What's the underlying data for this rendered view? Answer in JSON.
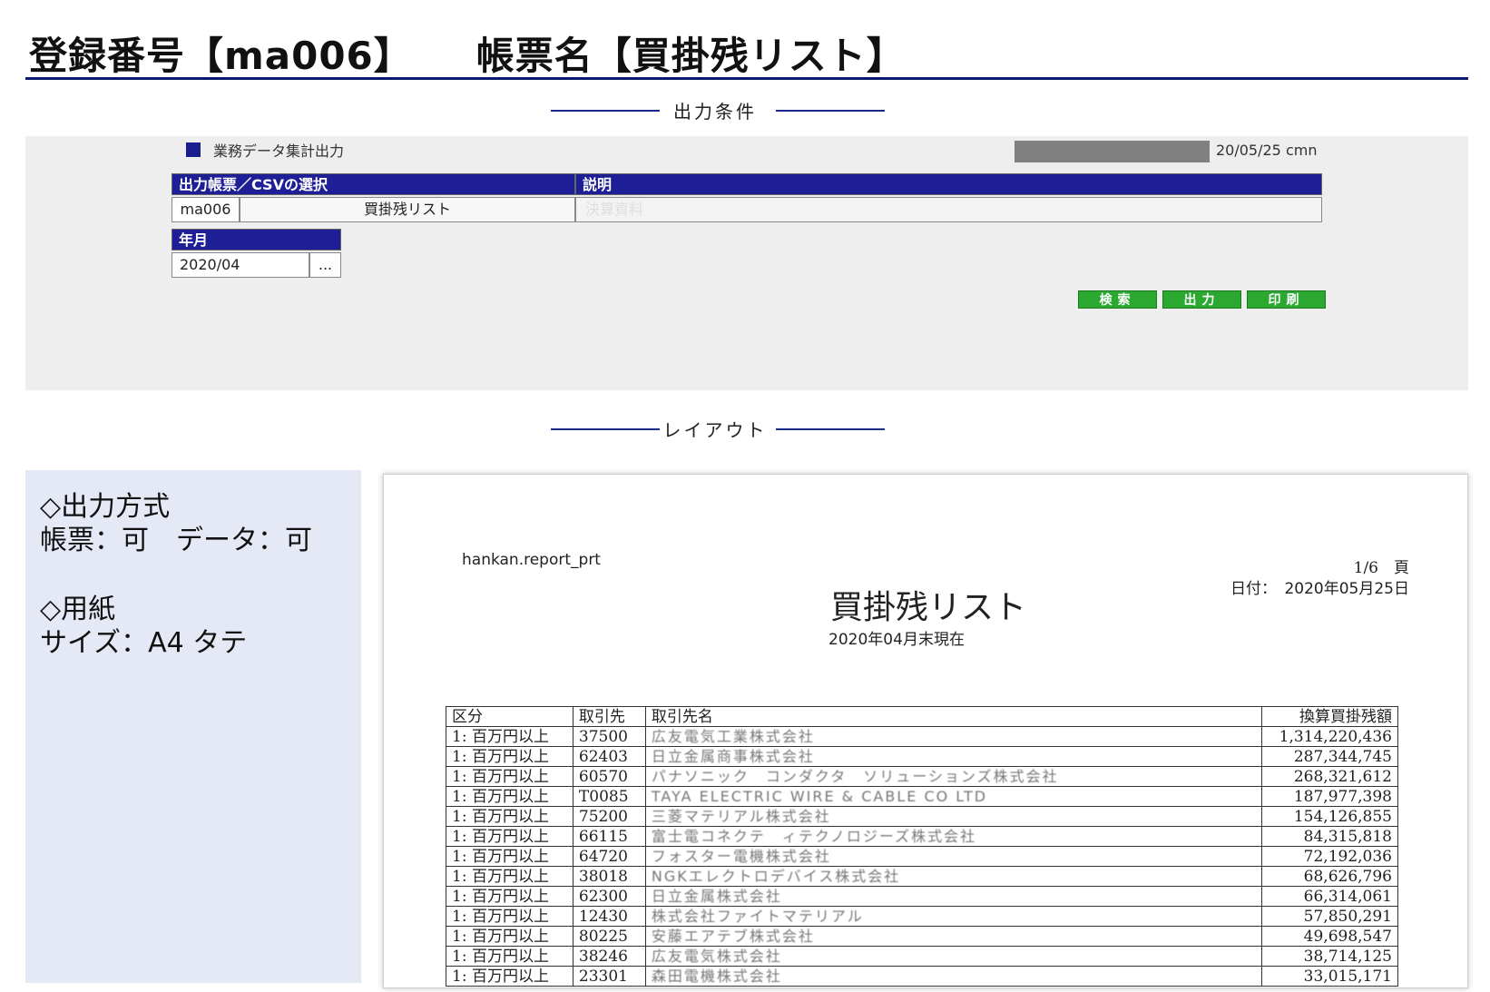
{
  "header": {
    "registration": "登録番号【ma006】",
    "form_name": "帳票名【買掛残リスト】"
  },
  "conditions": {
    "section_label": "出力条件",
    "subtitle": "業務データ集計出力",
    "date_user": "20/05/25 cmn",
    "form_select_header": "出力帳票／CSVの選択",
    "description_header": "説明",
    "form_code": "ma006",
    "form_title": "買掛残リスト",
    "description_value": "決算資料",
    "yearmonth_header": "年月",
    "yearmonth_value": "2020/04",
    "picker_label": "...",
    "buttons": {
      "search": "検索",
      "output": "出力",
      "print": "印刷"
    }
  },
  "layout": {
    "section_label": "レイアウト",
    "output_method_heading": "◇出力方式",
    "output_method_value": "帳票：可　データ：可",
    "paper_heading": "◇用紙",
    "paper_value": "サイズ：A4 タテ"
  },
  "report": {
    "program": "hankan.report_prt",
    "page": "1/6　頁",
    "date": "日付：　2020年05月25日",
    "title": "買掛残リスト",
    "subtitle": "2020年04月末現在",
    "columns": [
      "区分",
      "取引先",
      "取引先名",
      "換算買掛残額"
    ],
    "rows": [
      [
        "1: 百万円以上",
        "37500",
        "広友電気工業株式会社",
        "1,314,220,436"
      ],
      [
        "1: 百万円以上",
        "62403",
        "日立金属商事株式会社",
        "287,344,745"
      ],
      [
        "1: 百万円以上",
        "60570",
        "パナソニック　コンダクタ　ソリューションズ株式会社",
        "268,321,612"
      ],
      [
        "1: 百万円以上",
        "T0085",
        "TAYA ELECTRIC WIRE & CABLE CO LTD",
        "187,977,398"
      ],
      [
        "1: 百万円以上",
        "75200",
        "三菱マテリアル株式会社",
        "154,126,855"
      ],
      [
        "1: 百万円以上",
        "66115",
        "富士電コネクテ　ィテクノロジーズ株式会社",
        "84,315,818"
      ],
      [
        "1: 百万円以上",
        "64720",
        "フォスター電機株式会社",
        "72,192,036"
      ],
      [
        "1: 百万円以上",
        "38018",
        "NGKエレクトロデバイス株式会社",
        "68,626,796"
      ],
      [
        "1: 百万円以上",
        "62300",
        "日立金属株式会社",
        "66,314,061"
      ],
      [
        "1: 百万円以上",
        "12430",
        "株式会社ファイトマテリアル",
        "57,850,291"
      ],
      [
        "1: 百万円以上",
        "80225",
        "安藤エアテブ株式会社",
        "49,698,547"
      ],
      [
        "1: 百万円以上",
        "38246",
        "広友電気株式会社",
        "38,714,125"
      ],
      [
        "1: 百万円以上",
        "23301",
        "森田電機株式会社",
        "33,015,171"
      ]
    ]
  },
  "colors": {
    "navy": "#1e1e96",
    "rule": "#0d1a6b",
    "button_green": "#2aa830",
    "panel_gray": "#eeeeee",
    "panel_blue": "#e4e9f5"
  }
}
